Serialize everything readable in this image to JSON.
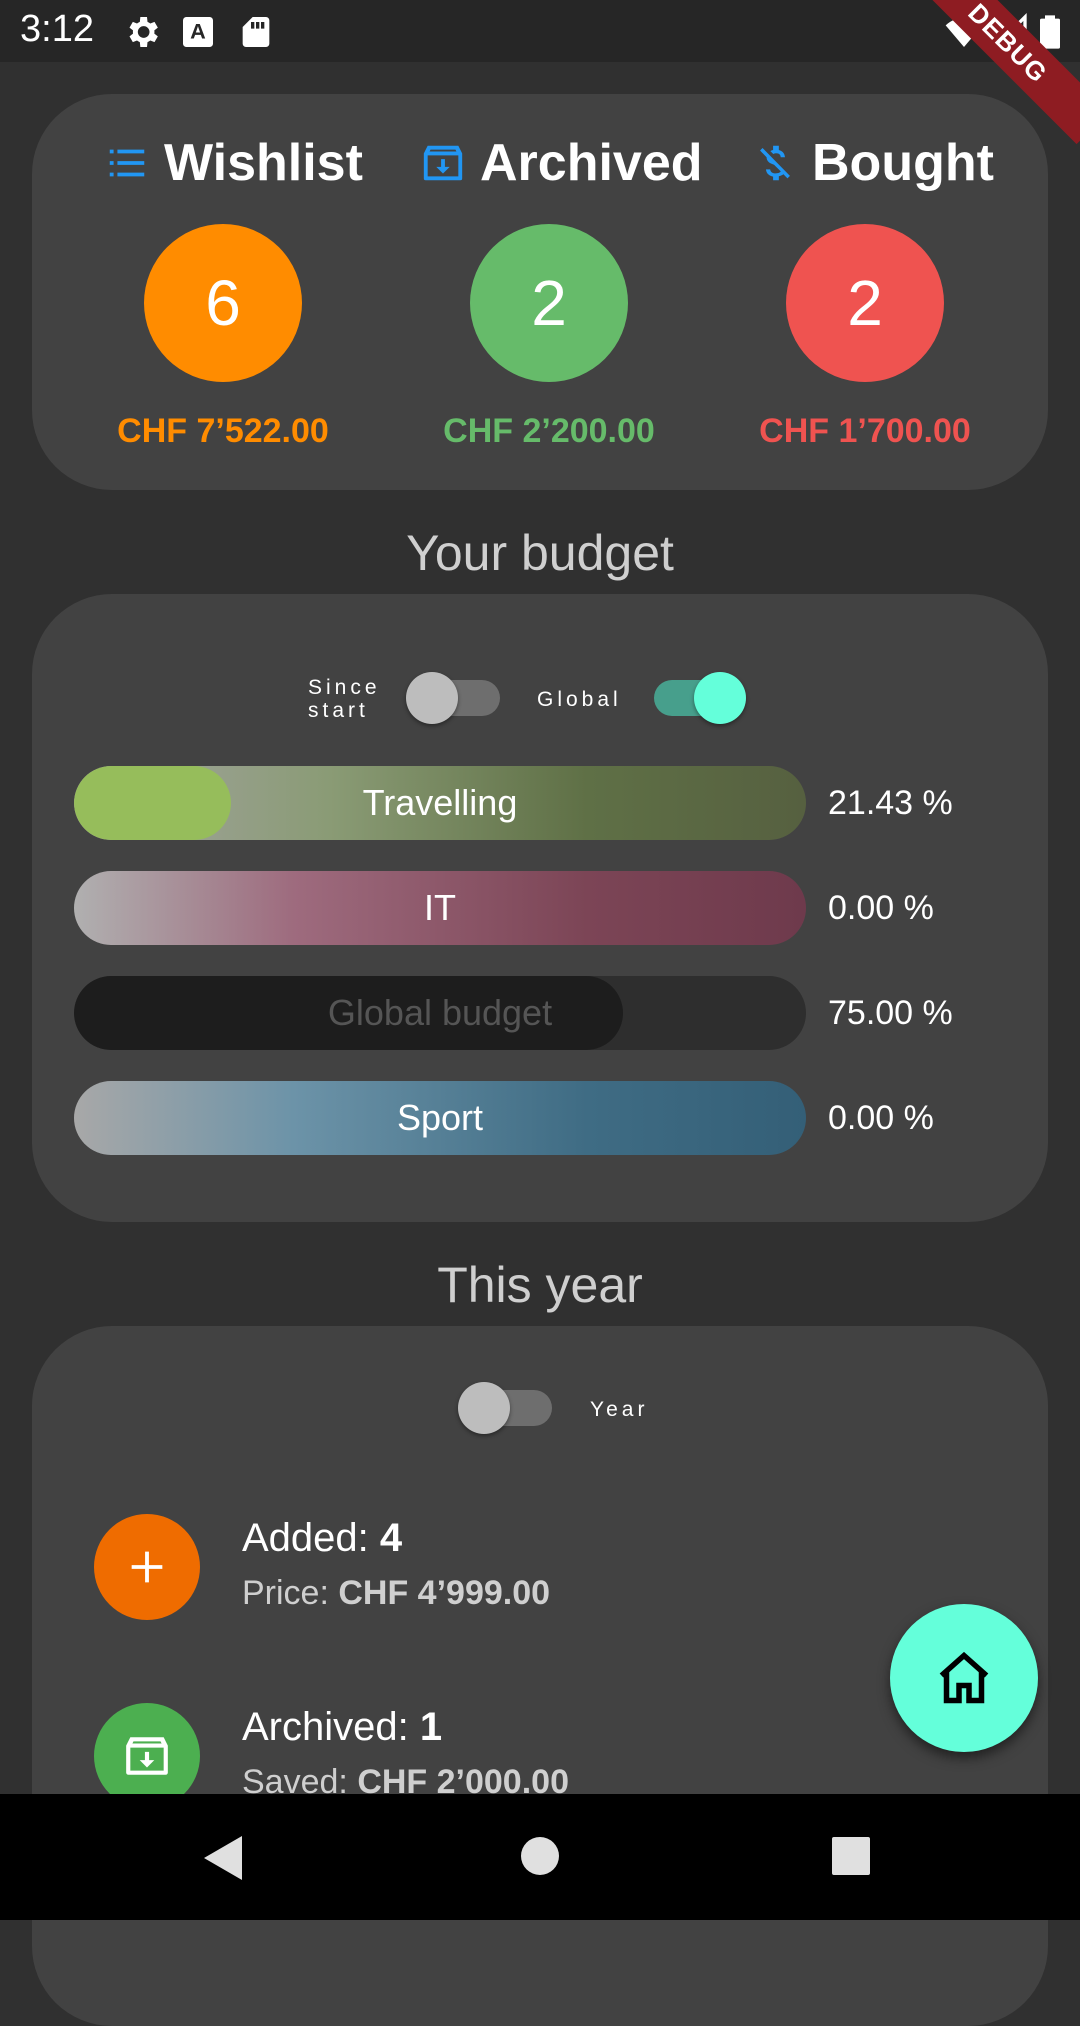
{
  "status_bar": {
    "time": "3:12",
    "debug_label": "DEBUG"
  },
  "summary": {
    "tabs": [
      {
        "icon": "list-icon",
        "label": "Wishlist",
        "count": "6",
        "amount": "CHF 7’522.00",
        "color": "#ff8c00"
      },
      {
        "icon": "archive-icon",
        "label": "Archived",
        "count": "2",
        "amount": "CHF 2’200.00",
        "color": "#66bb6a"
      },
      {
        "icon": "money-off-icon",
        "label": "Bought",
        "count": "2",
        "amount": "CHF 1’700.00",
        "color": "#ef5350"
      }
    ]
  },
  "budget": {
    "title": "Your budget",
    "toggle_since_start": {
      "label_line1": "Since",
      "label_line2": "start",
      "on": false
    },
    "toggle_global": {
      "label": "Global",
      "on": true
    },
    "bars": [
      {
        "name": "Travelling",
        "percent_text": "21.43 %",
        "fill": 0.2143
      },
      {
        "name": "IT",
        "percent_text": "0.00  %",
        "fill": 0.0
      },
      {
        "name": "Global budget",
        "percent_text": "75.00 %",
        "fill": 0.75
      },
      {
        "name": "Sport",
        "percent_text": "0.00  %",
        "fill": 0.0
      }
    ]
  },
  "this_year": {
    "title": "This year",
    "toggle_year": {
      "label": "Year",
      "on": false
    },
    "stats": [
      {
        "icon": "plus-icon",
        "title_prefix": "Added: ",
        "title_value": "4",
        "sub_prefix": "Price: ",
        "sub_value": "CHF 4’999.00",
        "color": "#ef6c00"
      },
      {
        "icon": "archive-icon",
        "title_prefix": "Archived: ",
        "title_value": "1",
        "sub_prefix": "Saved: ",
        "sub_value": "CHF 2’000.00",
        "color": "#4caf50"
      }
    ]
  },
  "fab": {
    "icon": "home-icon"
  },
  "nav_bar": {
    "back": "back-icon",
    "home": "home-circle-icon",
    "recents": "recents-icon"
  }
}
